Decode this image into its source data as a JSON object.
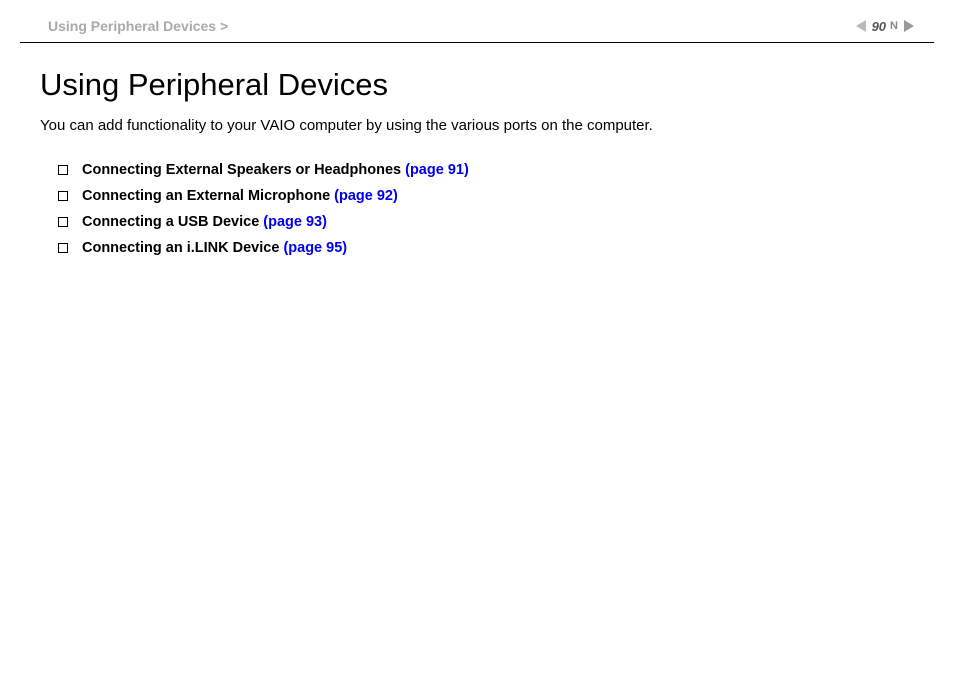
{
  "header": {
    "breadcrumb": "Using Peripheral Devices >",
    "page_number": "90",
    "n_label": "N"
  },
  "main": {
    "title": "Using Peripheral Devices",
    "intro": "You can add functionality to your VAIO computer by using the various ports on the computer.",
    "topics": [
      {
        "label": "Connecting External Speakers or Headphones",
        "page_ref": "(page 91)"
      },
      {
        "label": "Connecting an External Microphone",
        "page_ref": "(page 92)"
      },
      {
        "label": "Connecting a USB Device",
        "page_ref": "(page 93)"
      },
      {
        "label": "Connecting an i.LINK Device",
        "page_ref": "(page 95)"
      }
    ]
  }
}
